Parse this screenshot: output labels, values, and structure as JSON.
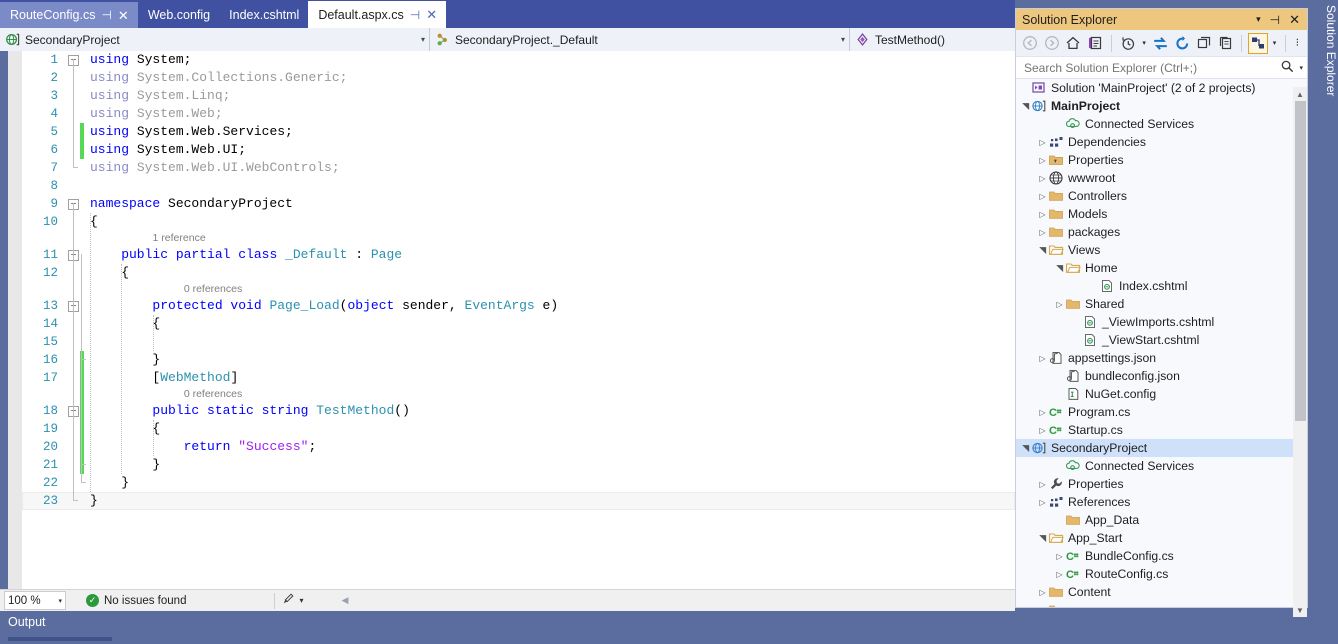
{
  "tabs": [
    {
      "label": "RouteConfig.cs",
      "state": "preview",
      "pin": "⊣",
      "close": "✕"
    },
    {
      "label": "Web.config",
      "state": "inactive"
    },
    {
      "label": "Index.cshtml",
      "state": "inactive"
    },
    {
      "label": "Default.aspx.cs",
      "state": "active",
      "pin": "⊣",
      "close": "✕"
    }
  ],
  "navbar": {
    "project": "SecondaryProject",
    "type": "SecondaryProject._Default",
    "member": "TestMethod()",
    "caret": "▾"
  },
  "editor": {
    "lines": [
      {
        "n": "1",
        "indent": 0,
        "tokens": [
          [
            "kw",
            "using"
          ],
          [
            "pl",
            " System;"
          ]
        ]
      },
      {
        "n": "2",
        "indent": 1,
        "tokens": [
          [
            "kw-d",
            "using"
          ],
          [
            "pl-d",
            " System.Collections.Generic;"
          ]
        ]
      },
      {
        "n": "3",
        "indent": 1,
        "tokens": [
          [
            "kw-d",
            "using"
          ],
          [
            "pl-d",
            " System.Linq;"
          ]
        ]
      },
      {
        "n": "4",
        "indent": 1,
        "tokens": [
          [
            "kw-d",
            "using"
          ],
          [
            "pl-d",
            " System.Web;"
          ]
        ]
      },
      {
        "n": "5",
        "indent": 1,
        "tokens": [
          [
            "kw",
            "using"
          ],
          [
            "pl",
            " System.Web.Services;"
          ]
        ]
      },
      {
        "n": "6",
        "indent": 1,
        "tokens": [
          [
            "kw",
            "using"
          ],
          [
            "pl",
            " System.Web.UI;"
          ]
        ]
      },
      {
        "n": "7",
        "indent": 1,
        "tokens": [
          [
            "kw-d",
            "using"
          ],
          [
            "pl-d",
            " System.Web.UI.WebControls;"
          ]
        ]
      },
      {
        "n": "8",
        "indent": 0,
        "tokens": []
      },
      {
        "n": "9",
        "indent": 0,
        "tokens": [
          [
            "kw",
            "namespace"
          ],
          [
            "pl",
            " SecondaryProject"
          ]
        ]
      },
      {
        "n": "10",
        "indent": 0,
        "tokens": [
          [
            "pl",
            "{"
          ]
        ]
      },
      {
        "n": "11",
        "indent": 1,
        "tokens": [
          [
            "kw",
            "    public"
          ],
          [
            "kw",
            " partial"
          ],
          [
            "kw",
            " class"
          ],
          [
            "ty",
            " _Default"
          ],
          [
            "pl",
            " : "
          ],
          [
            "ty",
            "Page"
          ]
        ]
      },
      {
        "n": "12",
        "indent": 1,
        "tokens": [
          [
            "pl",
            "    {"
          ]
        ]
      },
      {
        "n": "13",
        "indent": 2,
        "tokens": [
          [
            "kw",
            "        protected"
          ],
          [
            "kw",
            " void"
          ],
          [
            "pl",
            " "
          ],
          [
            "ty",
            "Page_Load"
          ],
          [
            "pl",
            "("
          ],
          [
            "kw",
            "object"
          ],
          [
            "pl",
            " sender, "
          ],
          [
            "ty",
            "EventArgs"
          ],
          [
            "pl",
            " e)"
          ]
        ]
      },
      {
        "n": "14",
        "indent": 2,
        "tokens": [
          [
            "pl",
            "        {"
          ]
        ]
      },
      {
        "n": "15",
        "indent": 2,
        "tokens": []
      },
      {
        "n": "16",
        "indent": 2,
        "tokens": [
          [
            "pl",
            "        }"
          ]
        ]
      },
      {
        "n": "17",
        "indent": 2,
        "tokens": [
          [
            "pl",
            "        ["
          ],
          [
            "att",
            "WebMethod"
          ],
          [
            "pl",
            "]"
          ]
        ]
      },
      {
        "n": "18",
        "indent": 2,
        "tokens": [
          [
            "kw",
            "        public"
          ],
          [
            "kw",
            " static"
          ],
          [
            "kw",
            " string"
          ],
          [
            "pl",
            " "
          ],
          [
            "ty",
            "TestMethod"
          ],
          [
            "pl",
            "()"
          ]
        ]
      },
      {
        "n": "19",
        "indent": 2,
        "tokens": [
          [
            "pl",
            "        {"
          ]
        ]
      },
      {
        "n": "20",
        "indent": 3,
        "tokens": [
          [
            "kw",
            "            return"
          ],
          [
            "pl",
            " "
          ],
          [
            "strp",
            "\"Success\""
          ],
          [
            "pl",
            ";"
          ]
        ]
      },
      {
        "n": "21",
        "indent": 2,
        "tokens": [
          [
            "pl",
            "        }"
          ]
        ]
      },
      {
        "n": "22",
        "indent": 1,
        "tokens": [
          [
            "pl",
            "    }"
          ]
        ]
      },
      {
        "n": "23",
        "indent": 0,
        "current": true,
        "tokens": [
          [
            "pl",
            "}"
          ]
        ]
      }
    ],
    "codelens": [
      {
        "text": "1 reference",
        "above_line": "11"
      },
      {
        "text": "0 references",
        "above_line": "13"
      },
      {
        "text": "0 references",
        "above_line": "18"
      }
    ],
    "outline_glyphs": [
      "1",
      "9",
      "11",
      "13",
      "18"
    ],
    "change_bars": [
      {
        "from_line": "5",
        "to_line": "6"
      },
      {
        "from_line": "16",
        "to_line": "21"
      }
    ]
  },
  "status": {
    "zoom": "100 %",
    "zoom_caret": "▾",
    "issues": "No issues found",
    "issues_glyph": "✓",
    "brush_caret": "▾",
    "left_caret": "◀"
  },
  "output": {
    "title": "Output"
  },
  "solution_explorer": {
    "title": "Solution Explorer",
    "title_controls": {
      "dropdown": "▾",
      "pin": "⊣",
      "close": "✕"
    },
    "toolbar": {
      "back": "back-arrow",
      "forward": "forward-arrow",
      "home": "home",
      "pending_changes": "pending-changes",
      "history": "history",
      "refresh": "refresh",
      "sync": "sync",
      "collapse_all": "collapse-all",
      "show_all_files": "show-all-files",
      "properties": "properties",
      "overflow": "⁝"
    },
    "search_placeholder": "Search Solution Explorer (Ctrl+;)",
    "search_value": "",
    "tree": [
      {
        "label": "Solution 'MainProject' (2 of 2 projects)",
        "depth": 0,
        "twist": "",
        "icon": "solution",
        "selected": false,
        "bold": false
      },
      {
        "label": "MainProject",
        "depth": 0,
        "twist": "▲",
        "icon": "webproject",
        "selected": false,
        "bold": true
      },
      {
        "label": "Connected Services",
        "depth": 2,
        "twist": "",
        "icon": "connected",
        "selected": false,
        "bold": false
      },
      {
        "label": "Dependencies",
        "depth": 1,
        "twist": "▶",
        "icon": "dependencies",
        "selected": false,
        "bold": false
      },
      {
        "label": "Properties",
        "depth": 1,
        "twist": "▶",
        "icon": "propfolder",
        "selected": false,
        "bold": false
      },
      {
        "label": "wwwroot",
        "depth": 1,
        "twist": "▶",
        "icon": "globe",
        "selected": false,
        "bold": false
      },
      {
        "label": "Controllers",
        "depth": 1,
        "twist": "▶",
        "icon": "folder",
        "selected": false,
        "bold": false
      },
      {
        "label": "Models",
        "depth": 1,
        "twist": "▶",
        "icon": "folder",
        "selected": false,
        "bold": false
      },
      {
        "label": "packages",
        "depth": 1,
        "twist": "▶",
        "icon": "folder",
        "selected": false,
        "bold": false
      },
      {
        "label": "Views",
        "depth": 1,
        "twist": "▲",
        "icon": "folderopen",
        "selected": false,
        "bold": false
      },
      {
        "label": "Home",
        "depth": 2,
        "twist": "▲",
        "icon": "folderopen",
        "selected": false,
        "bold": false
      },
      {
        "label": "Index.cshtml",
        "depth": 4,
        "twist": "",
        "icon": "cshtml",
        "selected": false,
        "bold": false
      },
      {
        "label": "Shared",
        "depth": 2,
        "twist": "▶",
        "icon": "folder",
        "selected": false,
        "bold": false
      },
      {
        "label": "_ViewImports.cshtml",
        "depth": 3,
        "twist": "",
        "icon": "cshtml",
        "selected": false,
        "bold": false
      },
      {
        "label": "_ViewStart.cshtml",
        "depth": 3,
        "twist": "",
        "icon": "cshtml",
        "selected": false,
        "bold": false
      },
      {
        "label": "appsettings.json",
        "depth": 1,
        "twist": "▶",
        "icon": "json",
        "selected": false,
        "bold": false
      },
      {
        "label": "bundleconfig.json",
        "depth": 2,
        "twist": "",
        "icon": "json",
        "selected": false,
        "bold": false
      },
      {
        "label": "NuGet.config",
        "depth": 2,
        "twist": "",
        "icon": "config",
        "selected": false,
        "bold": false
      },
      {
        "label": "Program.cs",
        "depth": 1,
        "twist": "▶",
        "icon": "csharp",
        "selected": false,
        "bold": false
      },
      {
        "label": "Startup.cs",
        "depth": 1,
        "twist": "▶",
        "icon": "csharp",
        "selected": false,
        "bold": false
      },
      {
        "label": "SecondaryProject",
        "depth": 0,
        "twist": "▲",
        "icon": "webproject",
        "selected": true,
        "bold": false
      },
      {
        "label": "Connected Services",
        "depth": 2,
        "twist": "",
        "icon": "connected",
        "selected": false,
        "bold": false
      },
      {
        "label": "Properties",
        "depth": 1,
        "twist": "▶",
        "icon": "wrench",
        "selected": false,
        "bold": false
      },
      {
        "label": "References",
        "depth": 1,
        "twist": "▶",
        "icon": "dependencies",
        "selected": false,
        "bold": false
      },
      {
        "label": "App_Data",
        "depth": 2,
        "twist": "",
        "icon": "folder",
        "selected": false,
        "bold": false
      },
      {
        "label": "App_Start",
        "depth": 1,
        "twist": "▲",
        "icon": "folderopen",
        "selected": false,
        "bold": false
      },
      {
        "label": "BundleConfig.cs",
        "depth": 2,
        "twist": "▶",
        "icon": "csharp",
        "selected": false,
        "bold": false
      },
      {
        "label": "RouteConfig.cs",
        "depth": 2,
        "twist": "▶",
        "icon": "csharp",
        "selected": false,
        "bold": false
      },
      {
        "label": "Content",
        "depth": 1,
        "twist": "▶",
        "icon": "folder",
        "selected": false,
        "bold": false
      },
      {
        "label": "",
        "depth": 1,
        "twist": "▶",
        "icon": "folder",
        "selected": false,
        "bold": false
      }
    ],
    "scroll_up": "▲",
    "scroll_down": "▼"
  },
  "dock": {
    "label": "Solution Explorer"
  },
  "colors": {
    "chrome": "#5b6c9e",
    "tabstrip": "#3f51a0",
    "se_title": "#eec77f",
    "selection": "#cfe0fb",
    "change_bar": "#57d957",
    "keyword": "#0000ff",
    "type": "#2b91af",
    "string": "#a020f0",
    "linenum": "#2b91af"
  }
}
